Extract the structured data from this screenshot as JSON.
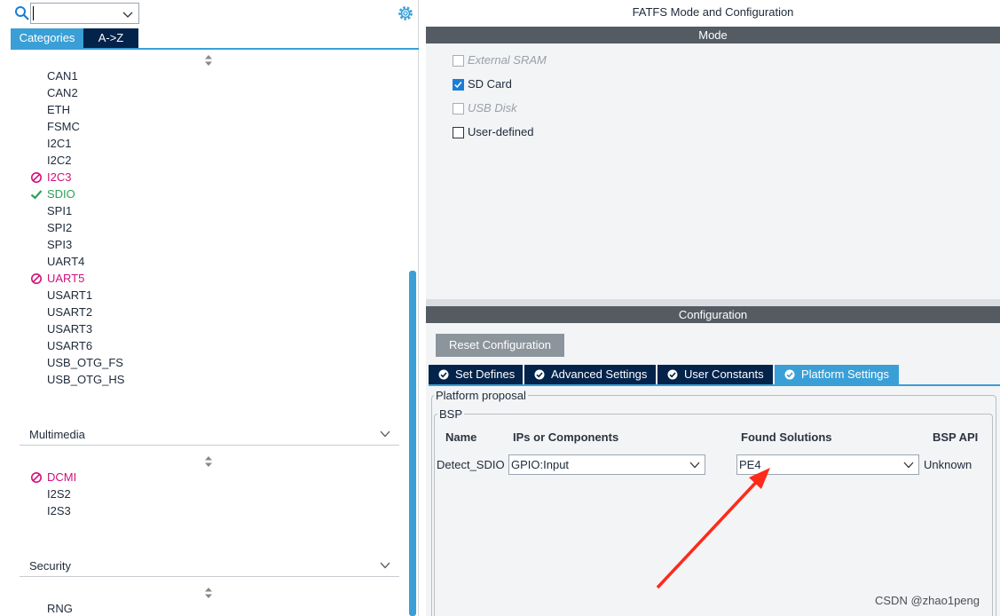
{
  "left_panel": {
    "search": {
      "value": "",
      "placeholder": ""
    },
    "tabs": [
      {
        "label": "Categories",
        "active": true
      },
      {
        "label": "A->Z",
        "active": false
      }
    ],
    "connectivity_items": [
      {
        "label": "CAN1",
        "status": "none"
      },
      {
        "label": "CAN2",
        "status": "none"
      },
      {
        "label": "ETH",
        "status": "none"
      },
      {
        "label": "FSMC",
        "status": "none"
      },
      {
        "label": "I2C1",
        "status": "none"
      },
      {
        "label": "I2C2",
        "status": "none"
      },
      {
        "label": "I2C3",
        "status": "error"
      },
      {
        "label": "SDIO",
        "status": "ok"
      },
      {
        "label": "SPI1",
        "status": "none"
      },
      {
        "label": "SPI2",
        "status": "none"
      },
      {
        "label": "SPI3",
        "status": "none"
      },
      {
        "label": "UART4",
        "status": "none"
      },
      {
        "label": "UART5",
        "status": "error"
      },
      {
        "label": "USART1",
        "status": "none"
      },
      {
        "label": "USART2",
        "status": "none"
      },
      {
        "label": "USART3",
        "status": "none"
      },
      {
        "label": "USART6",
        "status": "none"
      },
      {
        "label": "USB_OTG_FS",
        "status": "none"
      },
      {
        "label": "USB_OTG_HS",
        "status": "none"
      }
    ],
    "multimedia": {
      "label": "Multimedia",
      "items": [
        {
          "label": "DCMI",
          "status": "error"
        },
        {
          "label": "I2S2",
          "status": "none"
        },
        {
          "label": "I2S3",
          "status": "none"
        }
      ]
    },
    "security": {
      "label": "Security",
      "items": [
        {
          "label": "RNG",
          "status": "none"
        }
      ]
    }
  },
  "right_panel": {
    "title": "FATFS Mode and Configuration",
    "mode_header": "Mode",
    "mode_options": [
      {
        "label": "External SRAM",
        "checked": false,
        "disabled": true
      },
      {
        "label": "SD Card",
        "checked": true,
        "disabled": false
      },
      {
        "label": "USB Disk",
        "checked": false,
        "disabled": true
      },
      {
        "label": "User-defined",
        "checked": false,
        "disabled": false
      }
    ],
    "config_header": "Configuration",
    "reset_button": "Reset Configuration",
    "config_tabs": [
      {
        "label": "Set Defines",
        "active": false
      },
      {
        "label": "Advanced Settings",
        "active": false
      },
      {
        "label": "User Constants",
        "active": false
      },
      {
        "label": "Platform Settings",
        "active": true
      }
    ],
    "platform_proposal_label": "Platform proposal",
    "bsp_label": "BSP",
    "table": {
      "headers": [
        "Name",
        "IPs or Components",
        "Found Solutions",
        "BSP API"
      ],
      "row": {
        "name": "Detect_SDIO",
        "ip": "GPIO:Input",
        "solution": "PE4",
        "api": "Unknown"
      }
    }
  },
  "watermark": "CSDN @zhao1peng",
  "colors": {
    "accent": "#3a9fd6",
    "navy": "#03234b",
    "error": "#d0117a",
    "ok": "#2ca05a",
    "header_bar": "#545b63",
    "annotation_arrow": "#ff2a1a"
  }
}
